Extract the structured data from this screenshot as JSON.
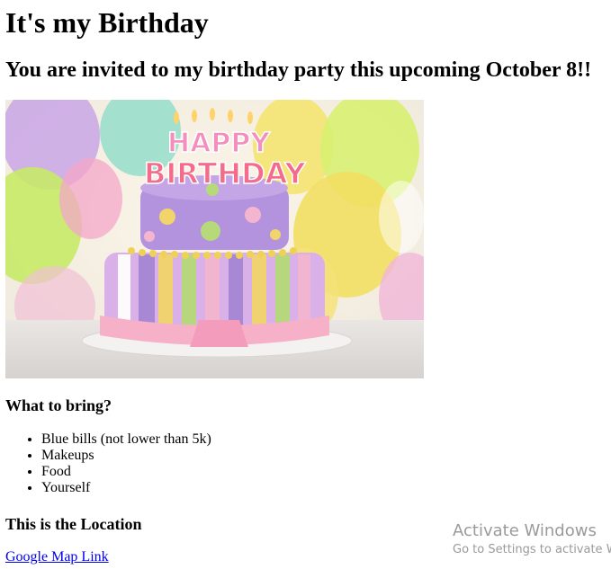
{
  "page": {
    "title": "It's my Birthday",
    "invitation": "You are invited to my birthday party this upcoming October 8!!"
  },
  "image": {
    "description": "birthday-cake-image",
    "candle_text_1": "HAPPY",
    "candle_text_2": "BIRTHDAY"
  },
  "bring": {
    "heading": "What to bring?",
    "items": [
      "Blue bills (not lower than 5k)",
      "Makeups",
      "Food",
      "Yourself"
    ]
  },
  "location": {
    "heading": "This is the Location",
    "link_text": "Google Map Link"
  },
  "watermark": {
    "title": "Activate Windows",
    "subtitle": "Go to Settings to activate W"
  },
  "colors": {
    "link": "#0000ee",
    "watermark": "#9a9a9a"
  }
}
